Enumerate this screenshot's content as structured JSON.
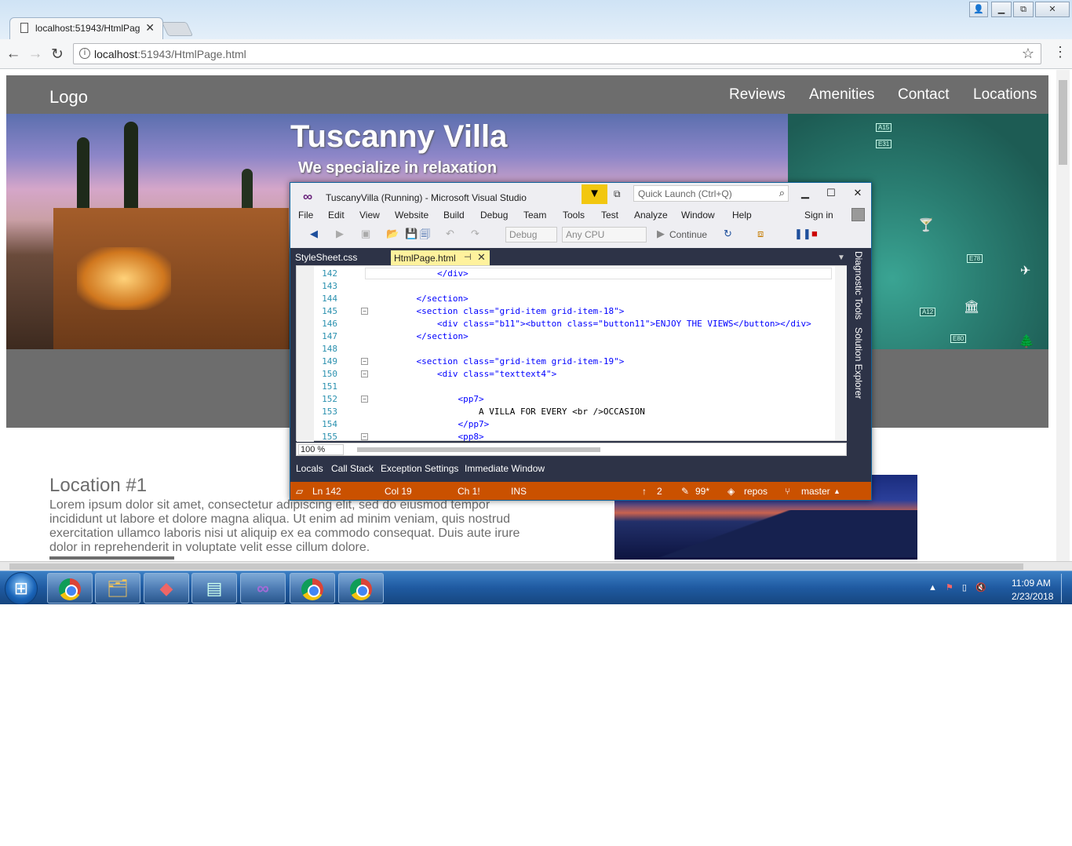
{
  "browser": {
    "tab_title": "localhost:51943/HtmlPag",
    "tab_close": "✕",
    "address_host": "localhost",
    "address_path": ":51943/HtmlPage.html",
    "back_icon": "arrow-left-icon",
    "forward_icon": "arrow-right-icon",
    "reload_icon": "reload-icon",
    "back_glyph": "←",
    "forward_glyph": "→",
    "reload_glyph": "↻",
    "info_glyph": "i",
    "star_glyph": "☆",
    "menu_glyph": "⋮",
    "win_min": "▁",
    "win_restore": "⧉",
    "win_close": "✕",
    "win_user": "👤"
  },
  "site": {
    "logo": "Logo",
    "nav": [
      "Reviews",
      "Amenities",
      "Contact",
      "Locations"
    ],
    "hero_title": "Tuscanny Villa",
    "hero_subtitle": "We specialize in relaxation",
    "map_labels": [
      "A15",
      "E31",
      "E78",
      "A12",
      "E80"
    ],
    "location_title": "Location #1",
    "location_text": "Lorem ipsum dolor sit amet, consectetur adipiscing elit, sed do eiusmod tempor incididunt ut labore et dolore magna aliqua. Ut enim ad minim veniam, quis nostrud exercitation ullamco laboris nisi ut aliquip ex ea commodo consequat. Duis aute irure dolor in reprehenderit in voluptate velit esse cillum dolore."
  },
  "vs": {
    "title": "TuscanyVilla (Running) - Microsoft Visual Studio",
    "quick_launch": "Quick Launch (Ctrl+Q)",
    "menu": [
      "File",
      "Edit",
      "View",
      "Website",
      "Build",
      "Debug",
      "Team",
      "Tools",
      "Test",
      "Analyze",
      "Window",
      "Help"
    ],
    "sign_in": "Sign in",
    "config": "Debug",
    "platform": "Any CPU",
    "continue": "Continue",
    "tabs": [
      "StyleSheet.css",
      "HtmlPage.html"
    ],
    "side_panels": [
      "Diagnostic Tools",
      "Solution Explorer"
    ],
    "zoom": "100 %",
    "bottom_tabs": [
      "Locals",
      "Call Stack",
      "Exception Settings",
      "Immediate Window"
    ],
    "status": {
      "ln": "Ln 142",
      "col": "Col 19",
      "ch": "Ch 1!",
      "ins": "INS",
      "up": "2",
      "pending": "99*",
      "repo": "repos",
      "branch": "master"
    },
    "code": [
      {
        "n": "142",
        "text": "        </div>"
      },
      {
        "n": "143",
        "text": ""
      },
      {
        "n": "144",
        "text": "    </section>"
      },
      {
        "n": "145",
        "text": "    <section class=\"grid-item grid-item-18\">"
      },
      {
        "n": "146",
        "text": "        <div class=\"b11\"><button class=\"button11\">ENJOY THE VIEWS</button></div>"
      },
      {
        "n": "147",
        "text": "    </section>"
      },
      {
        "n": "148",
        "text": ""
      },
      {
        "n": "149",
        "text": "    <section class=\"grid-item grid-item-19\">"
      },
      {
        "n": "150",
        "text": "        <div class=\"texttext4\">"
      },
      {
        "n": "151",
        "text": ""
      },
      {
        "n": "152",
        "text": "            <pp7>"
      },
      {
        "n": "153",
        "text": "                A VILLA FOR EVERY <br />OCCASION"
      },
      {
        "n": "154",
        "text": "            </pp7>"
      },
      {
        "n": "155",
        "text": "            <pp8>"
      }
    ]
  },
  "taskbar": {
    "time": "11:09 AM",
    "date": "2/23/2018",
    "apps": [
      "chrome-icon",
      "file-explorer-icon",
      "paint-icon",
      "notepad-icon",
      "visual-studio-icon",
      "chrome-icon",
      "chrome-icon"
    ]
  },
  "colors": {
    "site_gray": "#6d6d6d",
    "vs_dark": "#2d3347",
    "vs_status": "#ca5100",
    "taskbar": "#1f5aa1"
  }
}
